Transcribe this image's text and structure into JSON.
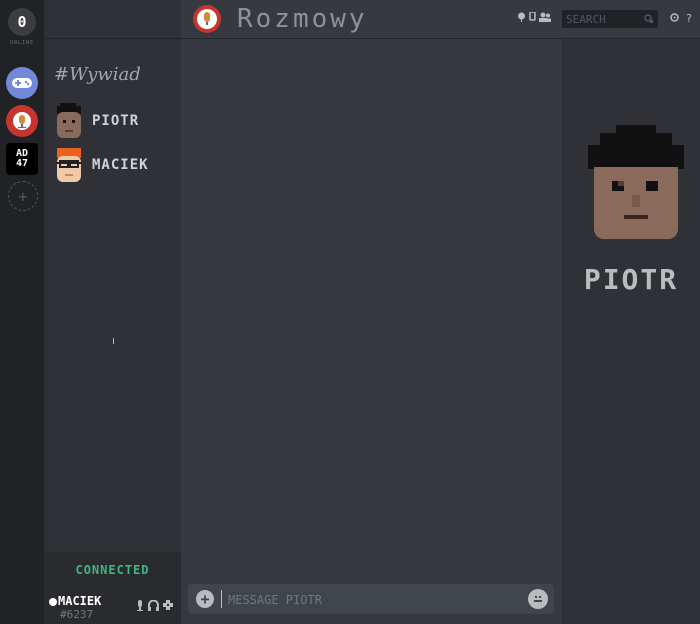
{
  "rail": {
    "home_label": "0",
    "home_caption": "ONLINE",
    "servers": [
      {
        "name": "gamepad-server"
      },
      {
        "name": "rozmowy-server"
      },
      {
        "name": "ad47-server",
        "label_top": "AD",
        "label_bottom": "47"
      }
    ],
    "add_symbol": "+"
  },
  "header": {
    "title": "Rozmowy",
    "search_placeholder": "SEARCH",
    "help": "?"
  },
  "channel": {
    "name": "#Wywiad"
  },
  "members": [
    {
      "name": "PIOTR",
      "skin": "#8a6a5a",
      "hair": "#111111"
    },
    {
      "name": "MACIEK",
      "skin": "#f1c9a6",
      "hair": "#e8641e"
    }
  ],
  "status": "CONNECTED",
  "user": {
    "name": "MACIEK",
    "tag": "#6237"
  },
  "composer": {
    "placeholder": "MESSAGE PIOTR"
  },
  "profile": {
    "name": "PIOTR"
  },
  "colors": {
    "accent_connected": "#43b581",
    "server_game": "#7289da",
    "server_red": "#c8342e"
  }
}
